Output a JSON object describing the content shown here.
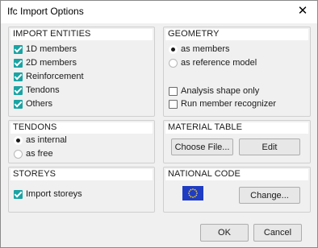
{
  "window": {
    "title": "Ifc Import Options",
    "close_glyph": "✕"
  },
  "import_entities": {
    "header": "IMPORT ENTITIES",
    "items": [
      {
        "label": "1D members",
        "checked": true
      },
      {
        "label": "2D members",
        "checked": true
      },
      {
        "label": "Reinforcement",
        "checked": true
      },
      {
        "label": "Tendons",
        "checked": true
      },
      {
        "label": "Others",
        "checked": true
      }
    ]
  },
  "geometry": {
    "header": "GEOMETRY",
    "options": [
      {
        "label": "as members",
        "selected": true
      },
      {
        "label": "as reference model",
        "selected": false
      }
    ],
    "checks": [
      {
        "label": "Analysis shape only",
        "checked": false
      },
      {
        "label": "Run member recognizer",
        "checked": false
      }
    ]
  },
  "tendons": {
    "header": "TENDONS",
    "options": [
      {
        "label": "as internal",
        "selected": true
      },
      {
        "label": "as free",
        "selected": false
      }
    ]
  },
  "material_table": {
    "header": "MATERIAL TABLE",
    "choose_file_label": "Choose File...",
    "edit_label": "Edit"
  },
  "storeys": {
    "header": "STOREYS",
    "import_storeys": {
      "label": "Import storeys",
      "checked": true
    }
  },
  "national_code": {
    "header": "NATIONAL CODE",
    "flag_icon": "eu-flag-icon",
    "change_label": "Change..."
  },
  "footer": {
    "ok_label": "OK",
    "cancel_label": "Cancel"
  },
  "colors": {
    "accent": "#1aa3a3",
    "flag_blue": "#1f3cc4",
    "flag_stars": "#ffd400"
  }
}
